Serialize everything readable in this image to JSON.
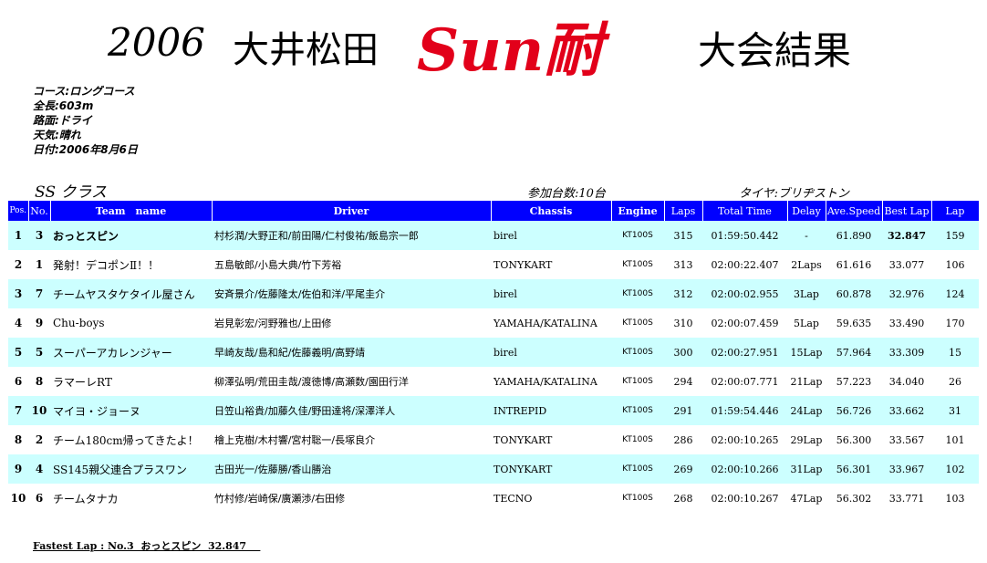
{
  "title": {
    "year": "2006",
    "place": "大井松田",
    "brand": "Sun耐",
    "result": "大会結果"
  },
  "info": [
    "コース:ロングコース",
    "全長:603m",
    "路面:ドライ",
    "天気:晴れ",
    "日付:2006年8月6日"
  ],
  "class_label": "SS クラス",
  "entry_count": "参加台数:10台",
  "tyre": "タイヤ:ブリヂストン",
  "columns": [
    "Pos.",
    "No.",
    "Team　name",
    "Driver",
    "Chassis",
    "Engine",
    "Laps",
    "Total Time",
    "Delay",
    "Ave.Speed",
    "Best Lap",
    "Lap"
  ],
  "rows": [
    {
      "pos": "1",
      "no": "3",
      "team": "おっとスピン",
      "driver": "村杉潤/大野正和/前田陽/仁村俊祐/飯島宗一郎",
      "chassis": "birel",
      "engine": "KT100S",
      "laps": "315",
      "total": "01:59:50.442",
      "delay": "-",
      "speed": "61.890",
      "best": "32.847",
      "lap": "159"
    },
    {
      "pos": "2",
      "no": "1",
      "team": "発射！デコポンⅡ！！",
      "driver": "五島敏郎/小島大典/竹下芳裕",
      "chassis": "TONYKART",
      "engine": "KT100S",
      "laps": "313",
      "total": "02:00:22.407",
      "delay": "2Laps",
      "speed": "61.616",
      "best": "33.077",
      "lap": "106"
    },
    {
      "pos": "3",
      "no": "7",
      "team": "チームヤスタケタイル屋さん",
      "driver": "安斉景介/佐藤隆太/佐伯和洋/平尾圭介",
      "chassis": "birel",
      "engine": "KT100S",
      "laps": "312",
      "total": "02:00:02.955",
      "delay": "3Lap",
      "speed": "60.878",
      "best": "32.976",
      "lap": "124"
    },
    {
      "pos": "4",
      "no": "9",
      "team": "Chu-boys",
      "driver": "岩見彰宏/河野雅也/上田修",
      "chassis": "YAMAHA/KATALINA",
      "engine": "KT100S",
      "laps": "310",
      "total": "02:00:07.459",
      "delay": "5Lap",
      "speed": "59.635",
      "best": "33.490",
      "lap": "170"
    },
    {
      "pos": "5",
      "no": "5",
      "team": "スーパーアカレンジャー",
      "driver": "早崎友哉/島和紀/佐藤義明/高野靖",
      "chassis": "birel",
      "engine": "KT100S",
      "laps": "300",
      "total": "02:00:27.951",
      "delay": "15Lap",
      "speed": "57.964",
      "best": "33.309",
      "lap": "15"
    },
    {
      "pos": "6",
      "no": "8",
      "team": "ラマーレRT",
      "driver": "柳澤弘明/荒田圭哉/渡徳博/高瀬数/園田行洋",
      "chassis": "YAMAHA/KATALINA",
      "engine": "KT100S",
      "laps": "294",
      "total": "02:00:07.771",
      "delay": "21Lap",
      "speed": "57.223",
      "best": "34.040",
      "lap": "26"
    },
    {
      "pos": "7",
      "no": "10",
      "team": "マイヨ・ジョーヌ",
      "driver": "日笠山裕貴/加藤久佳/野田達将/深澤洋人",
      "chassis": "INTREPID",
      "engine": "KT100S",
      "laps": "291",
      "total": "01:59:54.446",
      "delay": "24Lap",
      "speed": "56.726",
      "best": "33.662",
      "lap": "31"
    },
    {
      "pos": "8",
      "no": "2",
      "team": "チーム180cm帰ってきたよ！",
      "driver": "檜上克樹/木村響/宮村聡一/長塚良介",
      "chassis": "TONYKART",
      "engine": "KT100S",
      "laps": "286",
      "total": "02:00:10.265",
      "delay": "29Lap",
      "speed": "56.300",
      "best": "33.567",
      "lap": "101"
    },
    {
      "pos": "9",
      "no": "4",
      "team": "SS145親父連合プラスワン",
      "driver": "古田光一/佐藤勝/香山勝治",
      "chassis": "TONYKART",
      "engine": "KT100S",
      "laps": "269",
      "total": "02:00:10.266",
      "delay": "31Lap",
      "speed": "56.301",
      "best": "33.967",
      "lap": "102"
    },
    {
      "pos": "10",
      "no": "6",
      "team": "チームタナカ",
      "driver": "竹村修/岩崎保/廣瀬渉/右田修",
      "chassis": "TECNO",
      "engine": "KT100S",
      "laps": "268",
      "total": "02:00:10.267",
      "delay": "47Lap",
      "speed": "56.302",
      "best": "33.771",
      "lap": "103"
    }
  ],
  "fastest_lap": "Fastest Lap : No.3  おっとスピン  32.847    ",
  "colors": {
    "header_bg": "#0000ff",
    "row_alt": "#ccffff",
    "brand": "#e2001a"
  }
}
